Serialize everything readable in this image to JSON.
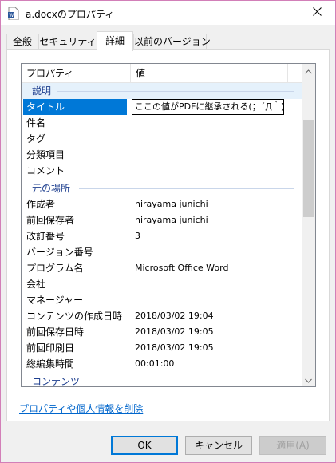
{
  "window": {
    "title": "a.docxのプロパティ"
  },
  "tabs": [
    {
      "label": "全般"
    },
    {
      "label": "セキュリティ"
    },
    {
      "label": "詳細"
    },
    {
      "label": "以前のバージョン"
    }
  ],
  "list": {
    "col_property": "プロパティ",
    "col_value": "値",
    "groups": {
      "description": "説明",
      "origin": "元の場所",
      "content": "コンテンツ"
    },
    "rows": {
      "title": {
        "label": "タイトル",
        "value": "ここの値がPDFに継承される(；´Д｀)"
      },
      "subject": {
        "label": "件名",
        "value": ""
      },
      "tags": {
        "label": "タグ",
        "value": ""
      },
      "categories": {
        "label": "分類項目",
        "value": ""
      },
      "comments": {
        "label": "コメント",
        "value": ""
      },
      "author": {
        "label": "作成者",
        "value": "hirayama junichi"
      },
      "last_saved_by": {
        "label": "前回保存者",
        "value": "hirayama junichi"
      },
      "revision": {
        "label": "改訂番号",
        "value": "3"
      },
      "version": {
        "label": "バージョン番号",
        "value": ""
      },
      "program": {
        "label": "プログラム名",
        "value": "Microsoft Office Word"
      },
      "company": {
        "label": "会社",
        "value": ""
      },
      "manager": {
        "label": "マネージャー",
        "value": ""
      },
      "created": {
        "label": "コンテンツの作成日時",
        "value": "2018/03/02 19:04"
      },
      "saved": {
        "label": "前回保存日時",
        "value": "2018/03/02 19:05"
      },
      "printed": {
        "label": "前回印刷日",
        "value": "2018/03/02 19:05"
      },
      "edit_time": {
        "label": "総編集時間",
        "value": "00:01:00"
      }
    }
  },
  "remove_link": "プロパティや個人情報を削除",
  "buttons": {
    "ok": "OK",
    "cancel": "キャンセル",
    "apply": "適用(A)"
  },
  "colors": {
    "selection": "#0078d7",
    "group_text": "#1e3f8f",
    "link": "#0066cc",
    "frame": "#d27fb8"
  },
  "icons": {
    "app": "word-document-icon",
    "close": "close-icon",
    "scroll_up": "chevron-up-icon",
    "scroll_down": "chevron-down-icon"
  }
}
